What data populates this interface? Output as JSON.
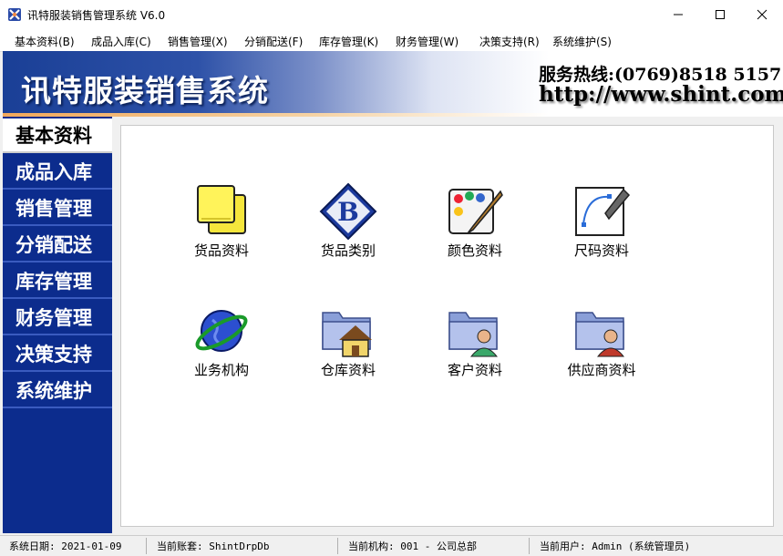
{
  "window": {
    "title": "讯特服装销售管理系统 V6.0"
  },
  "menu": [
    {
      "label": "基本资料(B)"
    },
    {
      "label": "成品入库(C)"
    },
    {
      "label": "销售管理(X)"
    },
    {
      "label": "分销配送(F)"
    },
    {
      "label": "库存管理(K)"
    },
    {
      "label": "财务管理(W)"
    },
    {
      "label": "决策支持(R)"
    },
    {
      "label": "系统维护(S)"
    }
  ],
  "banner": {
    "title": "讯特服装销售系统",
    "hotline": "服务热线:(0769)8518 5157",
    "url": "http://www.shint.com"
  },
  "sidebar": [
    {
      "label": "基本资料"
    },
    {
      "label": "成品入库"
    },
    {
      "label": "销售管理"
    },
    {
      "label": "分销配送"
    },
    {
      "label": "库存管理"
    },
    {
      "label": "财务管理"
    },
    {
      "label": "决策支持"
    },
    {
      "label": "系统维护"
    }
  ],
  "tiles": [
    {
      "label": "货品资料",
      "icon": "sticky-notes-icon"
    },
    {
      "label": "货品类别",
      "icon": "category-b-icon"
    },
    {
      "label": "颜色资料",
      "icon": "color-palette-icon"
    },
    {
      "label": "尺码资料",
      "icon": "pen-tool-icon"
    },
    {
      "label": "业务机构",
      "icon": "globe-icon"
    },
    {
      "label": "仓库资料",
      "icon": "warehouse-folder-icon"
    },
    {
      "label": "客户资料",
      "icon": "customer-folder-icon"
    },
    {
      "label": "供应商资料",
      "icon": "supplier-folder-icon"
    }
  ],
  "status": {
    "date": "系统日期: 2021-01-09",
    "account": "当前账套: ShintDrpDb",
    "org": "当前机构: 001 - 公司总部",
    "user": "当前用户: Admin  (系统管理员)"
  },
  "colors": {
    "sidebar": "#0c2c8d",
    "banner_blue": "#1a3f96",
    "accent_orange": "#f1a85a"
  }
}
